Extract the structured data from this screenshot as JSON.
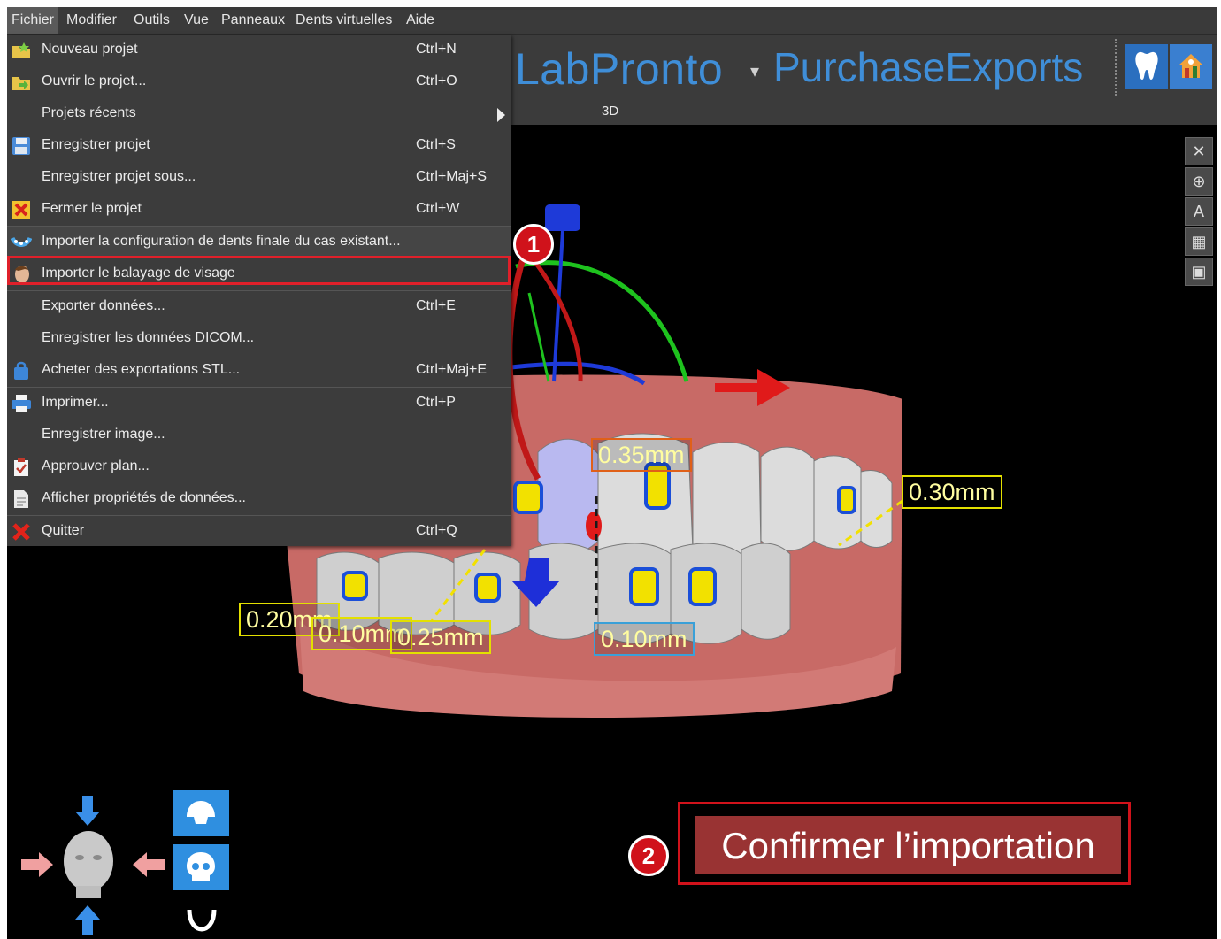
{
  "menubar": {
    "items": [
      "Fichier",
      "Modifier",
      "Outils",
      "Vue",
      "Panneaux",
      "Dents virtuelles",
      "Aide"
    ],
    "active": "Fichier"
  },
  "header": {
    "brand_left": "LabPronto",
    "brand_right": "PurchaseExports",
    "tab": "3D"
  },
  "file_menu": {
    "items": [
      {
        "label": "Nouveau projet",
        "shortcut": "Ctrl+N",
        "icon": "new-project-icon"
      },
      {
        "label": "Ouvrir le projet...",
        "shortcut": "Ctrl+O",
        "icon": "open-folder-icon"
      },
      {
        "label": "Projets récents",
        "shortcut": "",
        "icon": ""
      },
      {
        "label": "Enregistrer projet",
        "shortcut": "Ctrl+S",
        "icon": "save-icon"
      },
      {
        "label": "Enregistrer projet sous...",
        "shortcut": "Ctrl+Maj+S",
        "icon": ""
      },
      {
        "label": "Fermer le projet",
        "shortcut": "Ctrl+W",
        "icon": "close-project-icon"
      },
      {
        "label": "Importer la configuration de dents finale du cas existant...",
        "shortcut": "",
        "icon": "teeth-arch-icon"
      },
      {
        "label": "Importer le balayage de visage",
        "shortcut": "",
        "icon": "face-icon"
      },
      {
        "label": "Exporter données...",
        "shortcut": "Ctrl+E",
        "icon": ""
      },
      {
        "label": "Enregistrer les données DICOM...",
        "shortcut": "",
        "icon": ""
      },
      {
        "label": "Acheter des exportations STL...",
        "shortcut": "Ctrl+Maj+E",
        "icon": "shopping-bag-icon"
      },
      {
        "label": "Imprimer...",
        "shortcut": "Ctrl+P",
        "icon": "printer-icon"
      },
      {
        "label": "Enregistrer image...",
        "shortcut": "",
        "icon": ""
      },
      {
        "label": "Approuver plan...",
        "shortcut": "",
        "icon": "clipboard-icon"
      },
      {
        "label": "Afficher propriétés de données...",
        "shortcut": "",
        "icon": "document-icon"
      },
      {
        "label": "Quitter",
        "shortcut": "Ctrl+Q",
        "icon": "quit-icon"
      }
    ]
  },
  "annotations": {
    "step1": "1",
    "step2": "2"
  },
  "measurements": {
    "m035": "0.35mm",
    "m030": "0.30mm",
    "m020": "0.20mm",
    "m010a": "0.10mm",
    "m025": "0.25mm",
    "m010b": "0.10mm"
  },
  "confirm_button": "Confirmer l’importation",
  "colors": {
    "menu_bg": "#3c3c3c",
    "accent_blue": "#3f8ed8",
    "highlight_red": "#d0121b",
    "confirm_bg": "#993333",
    "measure_yellow": "#e3e000"
  }
}
